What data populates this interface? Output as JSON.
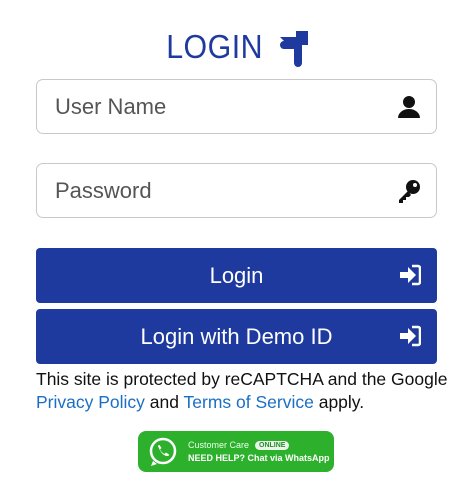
{
  "header": {
    "title": "LOGIN",
    "icon": "hand-pointing-down-icon"
  },
  "form": {
    "username": {
      "placeholder": "User Name",
      "value": "",
      "icon": "user-icon"
    },
    "password": {
      "placeholder": "Password",
      "value": "",
      "icon": "key-icon"
    },
    "login_label": "Login",
    "demo_label": "Login with Demo ID",
    "button_icon": "sign-in-icon"
  },
  "notice": {
    "prefix": "This site is protected by reCAPTCHA and the Google",
    "privacy_label": "Privacy Policy",
    "and": " and ",
    "terms_label": "Terms of Service",
    "suffix": " apply."
  },
  "whatsapp": {
    "care_label": "Customer Care",
    "badge": "ONLINE",
    "help_label": "NEED HELP? Chat via WhatsApp",
    "icon": "whatsapp-icon"
  },
  "colors": {
    "primary": "#1e3a9e",
    "link": "#1a6fc4",
    "whatsapp_green": "#2db12d"
  }
}
